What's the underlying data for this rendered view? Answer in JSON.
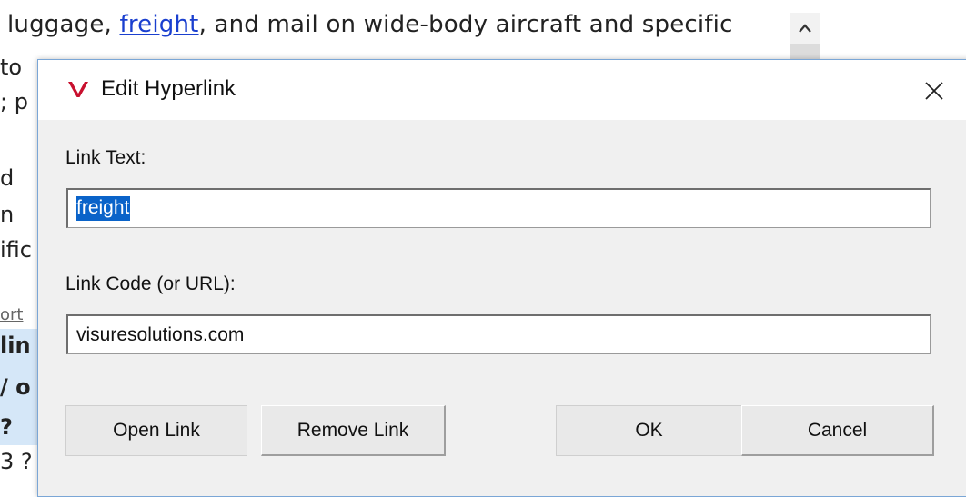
{
  "document": {
    "line_before": "luggage, ",
    "link_word": "freight",
    "line_after": ", and mail on wide-body aircraft and specific",
    "left_fragments": [
      "to",
      "; p",
      "d",
      " n",
      "ific",
      "ort",
      "lin",
      "/ o",
      " ?",
      "3 ?"
    ]
  },
  "dialog": {
    "title": "Edit Hyperlink",
    "link_text_label": "Link Text:",
    "link_text_value": "freight",
    "link_code_label": "Link Code (or URL):",
    "link_code_value": "visuresolutions.com",
    "buttons": {
      "open_link": "Open Link",
      "remove_link": "Remove Link",
      "ok": "OK",
      "cancel": "Cancel"
    }
  },
  "colors": {
    "accent": "#0a63c9",
    "link": "#1a3fcf",
    "brand_icon": "#c8102e"
  },
  "icons": {
    "app": "visure-v-icon",
    "close": "close-icon",
    "scroll_up": "chevron-up-icon"
  }
}
